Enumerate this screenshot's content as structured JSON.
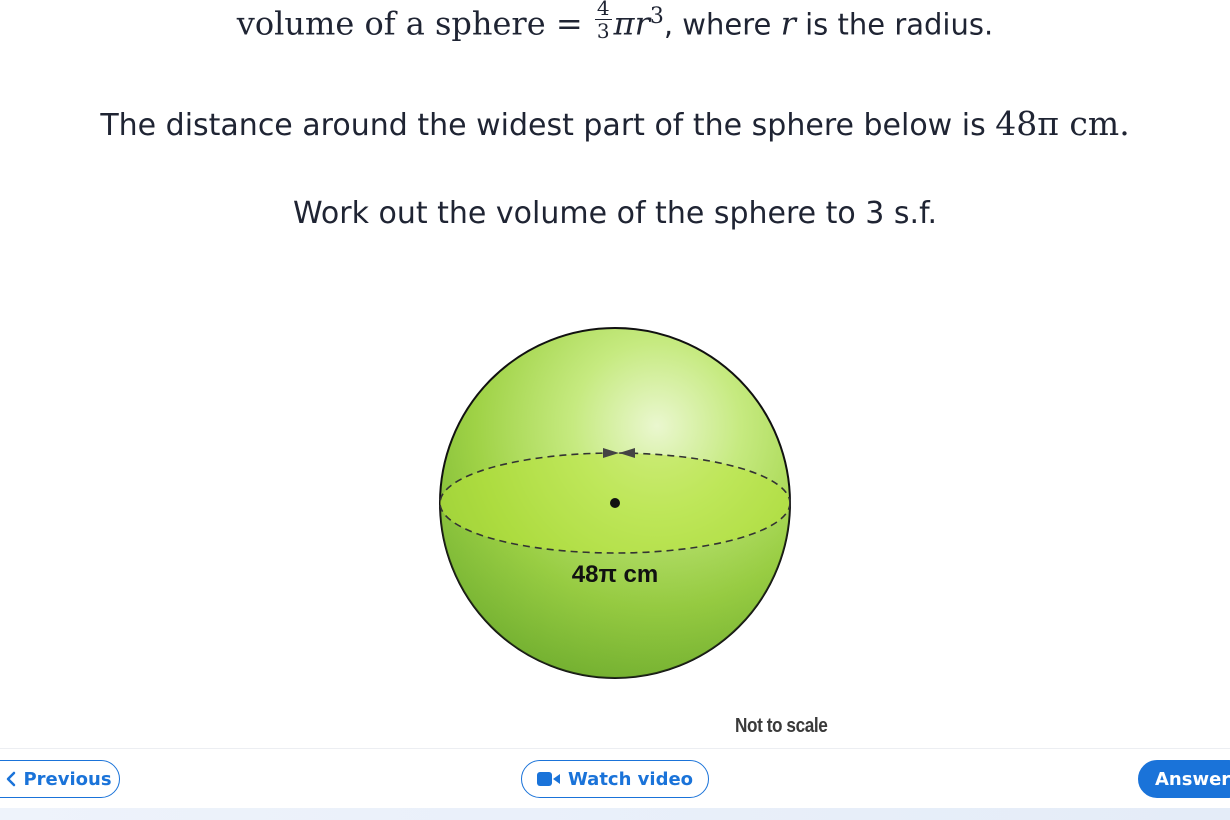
{
  "formula": {
    "lhs": "volume of a sphere",
    "eq": "=",
    "frac_num": "4",
    "frac_den": "3",
    "pi_r": "πr",
    "exponent": "3",
    "tail": ", where ",
    "var": "r",
    "tail2": " is the radius."
  },
  "question": {
    "line2_text": "The distance around the widest part of the sphere below is ",
    "line2_math": "48π cm.",
    "line3": "Work out the volume of the sphere to 3 s.f."
  },
  "figure": {
    "label": "48π cm",
    "note": "Not to scale",
    "colors": {
      "outline": "#111111",
      "fill_light": "#e4f5c4",
      "fill_mid": "#a9db4a",
      "fill_dark": "#6fae2c",
      "equator": "#b8e33a"
    }
  },
  "nav": {
    "previous_label": "Previous",
    "watch_label": "Watch video",
    "answer_label": "Answer",
    "accent": "#1a73d9"
  }
}
